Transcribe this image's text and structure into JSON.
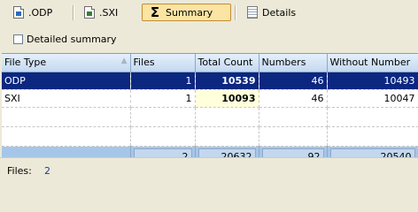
{
  "tabs": [
    {
      "label": ".ODP",
      "icon": "odp-file-icon"
    },
    {
      "label": ".SXI",
      "icon": "sxi-file-icon"
    },
    {
      "label": "Summary",
      "icon": "sigma-icon"
    },
    {
      "label": "Details",
      "icon": "notes-icon"
    }
  ],
  "active_tab": "Summary",
  "detailed_summary": {
    "label": "Detailed summary",
    "checked": false
  },
  "table": {
    "columns": [
      "File Type",
      "Files",
      "Total Count",
      "Numbers",
      "Without Number"
    ],
    "sort_column": "File Type",
    "rows": [
      {
        "type": "ODP",
        "files": "1",
        "total": "10539",
        "numbers": "46",
        "without": "10493",
        "selected": true
      },
      {
        "type": "SXI",
        "files": "1",
        "total": "10093",
        "numbers": "46",
        "without": "10047",
        "selected": false
      }
    ],
    "totals": {
      "files": "2",
      "total": "20632",
      "numbers": "92",
      "without": "20540"
    }
  },
  "status": {
    "label": "Files:",
    "value": "2"
  },
  "colors": {
    "selection": "#0b2780",
    "header": "#c4d9f0",
    "totals": "#a6c6e8",
    "highlight": "#ffffdc"
  }
}
